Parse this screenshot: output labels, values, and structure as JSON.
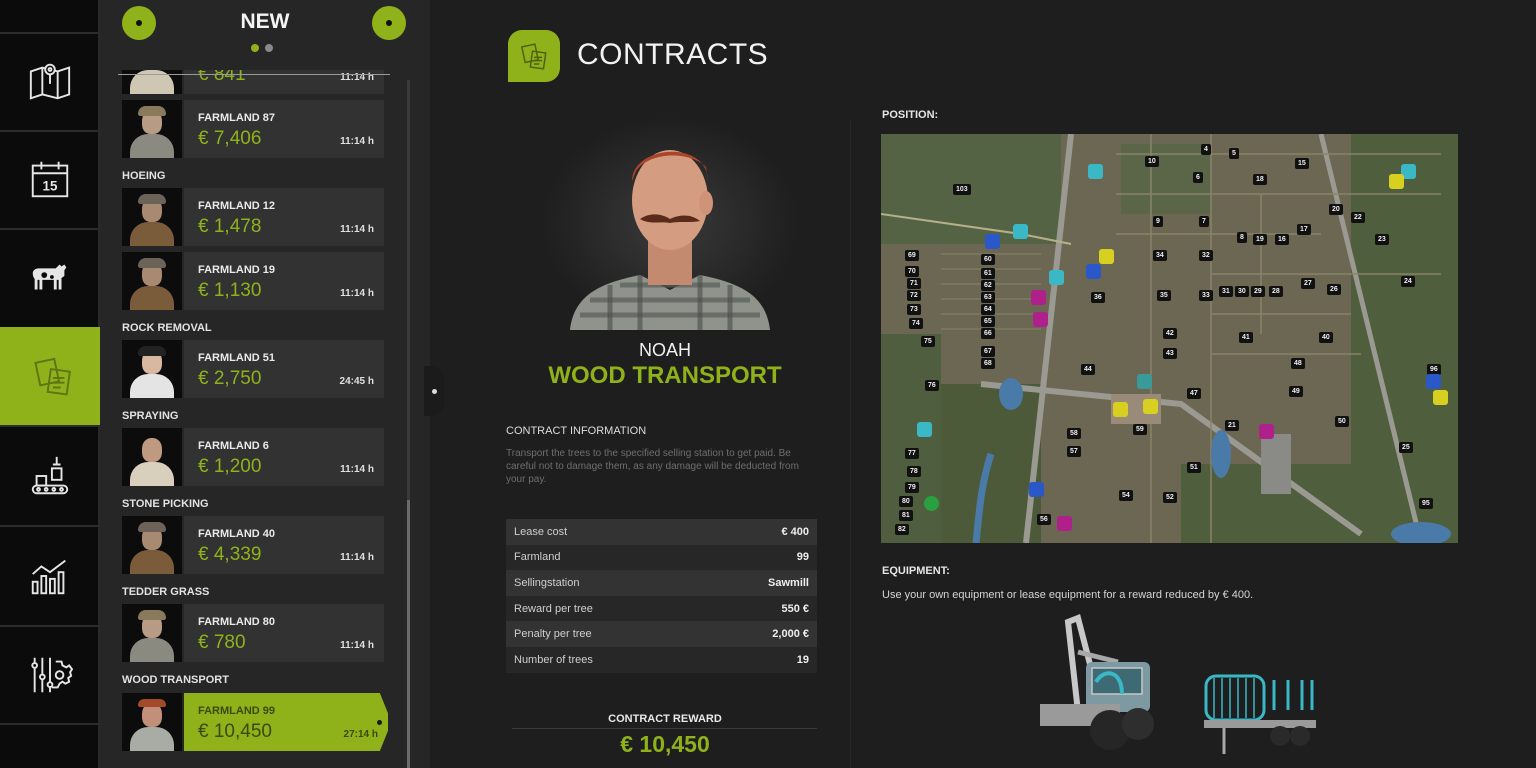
{
  "nav": {
    "items": [
      {
        "id": "map",
        "icon": "map-icon",
        "active": false
      },
      {
        "id": "calendar",
        "icon": "calendar-icon",
        "label": "15",
        "active": false
      },
      {
        "id": "animals",
        "icon": "cow-icon",
        "active": false
      },
      {
        "id": "contracts",
        "icon": "contracts-icon",
        "active": true
      },
      {
        "id": "production",
        "icon": "production-icon",
        "active": false
      },
      {
        "id": "statistics",
        "icon": "statistics-icon",
        "active": false
      },
      {
        "id": "settings",
        "icon": "settings-icon",
        "active": false
      }
    ]
  },
  "list": {
    "title": "NEW",
    "page_count": 2,
    "current_page": 1,
    "partial_row": {
      "price": "€ 841",
      "time": "11:14 h"
    },
    "groups": [
      {
        "category": "",
        "items": [
          {
            "farmland": "FARMLAND 87",
            "price": "€ 7,406",
            "time": "11:14 h"
          }
        ]
      },
      {
        "category": "HOEING",
        "items": [
          {
            "farmland": "FARMLAND 12",
            "price": "€ 1,478",
            "time": "11:14 h"
          },
          {
            "farmland": "FARMLAND 19",
            "price": "€ 1,130",
            "time": "11:14 h"
          }
        ]
      },
      {
        "category": "ROCK REMOVAL",
        "items": [
          {
            "farmland": "FARMLAND 51",
            "price": "€ 2,750",
            "time": "24:45 h"
          }
        ]
      },
      {
        "category": "SPRAYING",
        "items": [
          {
            "farmland": "FARMLAND 6",
            "price": "€ 1,200",
            "time": "11:14 h"
          }
        ]
      },
      {
        "category": "STONE PICKING",
        "items": [
          {
            "farmland": "FARMLAND 40",
            "price": "€ 4,339",
            "time": "11:14 h"
          }
        ]
      },
      {
        "category": "TEDDER GRASS",
        "items": [
          {
            "farmland": "FARMLAND 80",
            "price": "€ 780",
            "time": "11:14 h"
          }
        ]
      },
      {
        "category": "WOOD TRANSPORT",
        "items": [
          {
            "farmland": "FARMLAND 99",
            "price": "€ 10,450",
            "time": "27:14 h",
            "selected": true
          }
        ]
      }
    ]
  },
  "header": {
    "title": "CONTRACTS"
  },
  "contract": {
    "npc_name": "NOAH",
    "job": "WOOD TRANSPORT",
    "info_title": "CONTRACT INFORMATION",
    "description": "Transport the trees to the specified selling station to get paid. Be careful not to damage them, as any damage will be deducted from your pay.",
    "details": [
      {
        "label": "Lease cost",
        "value": "€ 400"
      },
      {
        "label": "Farmland",
        "value": "99"
      },
      {
        "label": "Sellingstation",
        "value": "Sawmill"
      },
      {
        "label": "Reward per tree",
        "value": "550 €"
      },
      {
        "label": "Penalty per tree",
        "value": "2,000 €"
      },
      {
        "label": "Number of trees",
        "value": "19"
      }
    ],
    "reward_title": "CONTRACT REWARD",
    "reward_value": "€ 10,450"
  },
  "position": {
    "title": "POSITION:",
    "field_labels": [
      "103",
      "10",
      "4",
      "5",
      "6",
      "15",
      "18",
      "9",
      "7",
      "20",
      "22",
      "8",
      "19",
      "16",
      "17",
      "23",
      "34",
      "32",
      "69",
      "60",
      "70",
      "61",
      "71",
      "62",
      "72",
      "63",
      "73",
      "64",
      "74",
      "65",
      "66",
      "67",
      "68",
      "75",
      "36",
      "35",
      "33",
      "31",
      "30",
      "29",
      "28",
      "27",
      "26",
      "24",
      "42",
      "43",
      "41",
      "40",
      "44",
      "48",
      "49",
      "47",
      "76",
      "96",
      "50",
      "58",
      "59",
      "57",
      "21",
      "25",
      "77",
      "78",
      "79",
      "80",
      "81",
      "82",
      "51",
      "54",
      "52",
      "56",
      "95"
    ]
  },
  "equipment": {
    "title": "EQUIPMENT:",
    "description": "Use your own equipment or lease equipment for a reward reduced by € 400.",
    "items": [
      {
        "name": "forestry-tractor"
      },
      {
        "name": "forestry-trailer"
      }
    ]
  },
  "colors": {
    "accent": "#8fb21b",
    "background": "#1e1e1e",
    "panel": "#262626",
    "card": "#323232"
  }
}
